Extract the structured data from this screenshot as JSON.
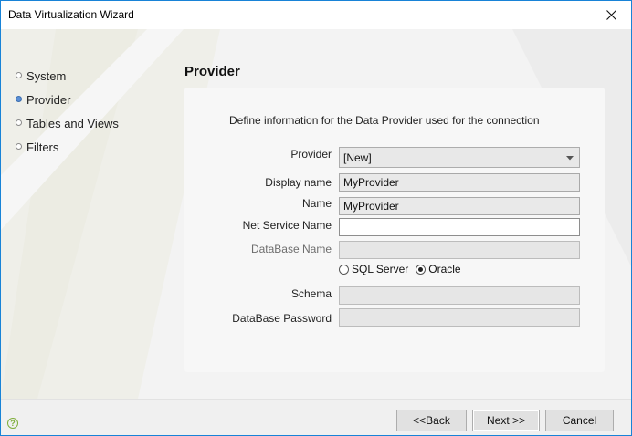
{
  "window": {
    "title": "Data Virtualization Wizard",
    "close_icon": "close-icon"
  },
  "nav": {
    "items": [
      {
        "label": "System",
        "active": false
      },
      {
        "label": "Provider",
        "active": true
      },
      {
        "label": "Tables and Views",
        "active": false
      },
      {
        "label": "Filters",
        "active": false
      }
    ]
  },
  "page": {
    "title": "Provider",
    "description": "Define information for the Data Provider used for the connection"
  },
  "form": {
    "provider": {
      "label": "Provider",
      "value": "[New]"
    },
    "display_name": {
      "label": "Display name",
      "value": "MyProvider"
    },
    "name": {
      "label": "Name",
      "value": "MyProvider"
    },
    "net_service_name": {
      "label": "Net Service Name",
      "value": ""
    },
    "database_name": {
      "label": "DataBase Name",
      "value": ""
    },
    "db_type": {
      "options": [
        "SQL Server",
        "Oracle"
      ],
      "selected": "Oracle"
    },
    "schema": {
      "label": "Schema",
      "value": ""
    },
    "database_password": {
      "label": "DataBase Password",
      "value": ""
    }
  },
  "footer": {
    "help_icon": "help-icon",
    "back_label": "<<Back",
    "next_label": "Next >>",
    "cancel_label": "Cancel"
  }
}
